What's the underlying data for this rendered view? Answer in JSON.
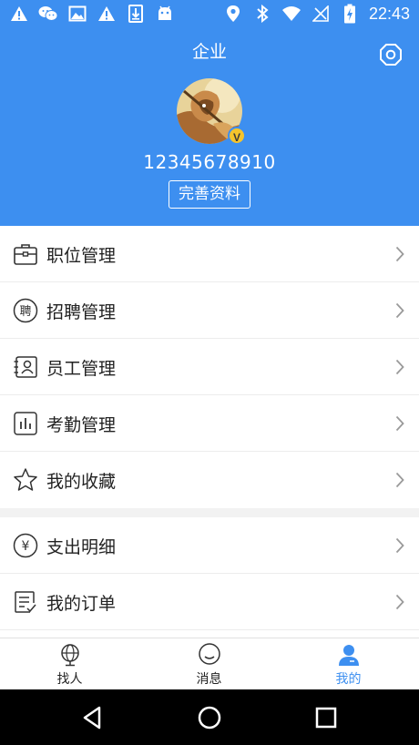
{
  "status_bar": {
    "time": "22:43",
    "left_icons": [
      "warning-icon",
      "wechat-icon",
      "image-icon",
      "warning-icon",
      "download-icon",
      "android-icon"
    ],
    "right_icons": [
      "location-icon",
      "bluetooth-icon",
      "wifi-icon",
      "no-signal-icon",
      "battery-charging-icon"
    ]
  },
  "header": {
    "title": "企业",
    "phone": "12345678910",
    "complete_profile": "完善资料",
    "badge": "V"
  },
  "menu_group_1": [
    {
      "label": "职位管理",
      "icon": "briefcase-icon"
    },
    {
      "label": "招聘管理",
      "icon": "recruit-icon"
    },
    {
      "label": "员工管理",
      "icon": "employee-icon"
    },
    {
      "label": "考勤管理",
      "icon": "bar-chart-icon"
    },
    {
      "label": "我的收藏",
      "icon": "star-icon"
    }
  ],
  "menu_group_2": [
    {
      "label": "支出明细",
      "icon": "yen-icon"
    },
    {
      "label": "我的订单",
      "icon": "order-icon"
    }
  ],
  "recruit_icon_char": "聘",
  "yen_char": "¥",
  "bottom_nav": [
    {
      "label": "找人",
      "icon": "globe-icon"
    },
    {
      "label": "消息",
      "icon": "smile-icon"
    },
    {
      "label": "我的",
      "icon": "user-icon"
    }
  ],
  "colors": {
    "primary": "#3d8ff0",
    "badge": "#f5c42c"
  }
}
